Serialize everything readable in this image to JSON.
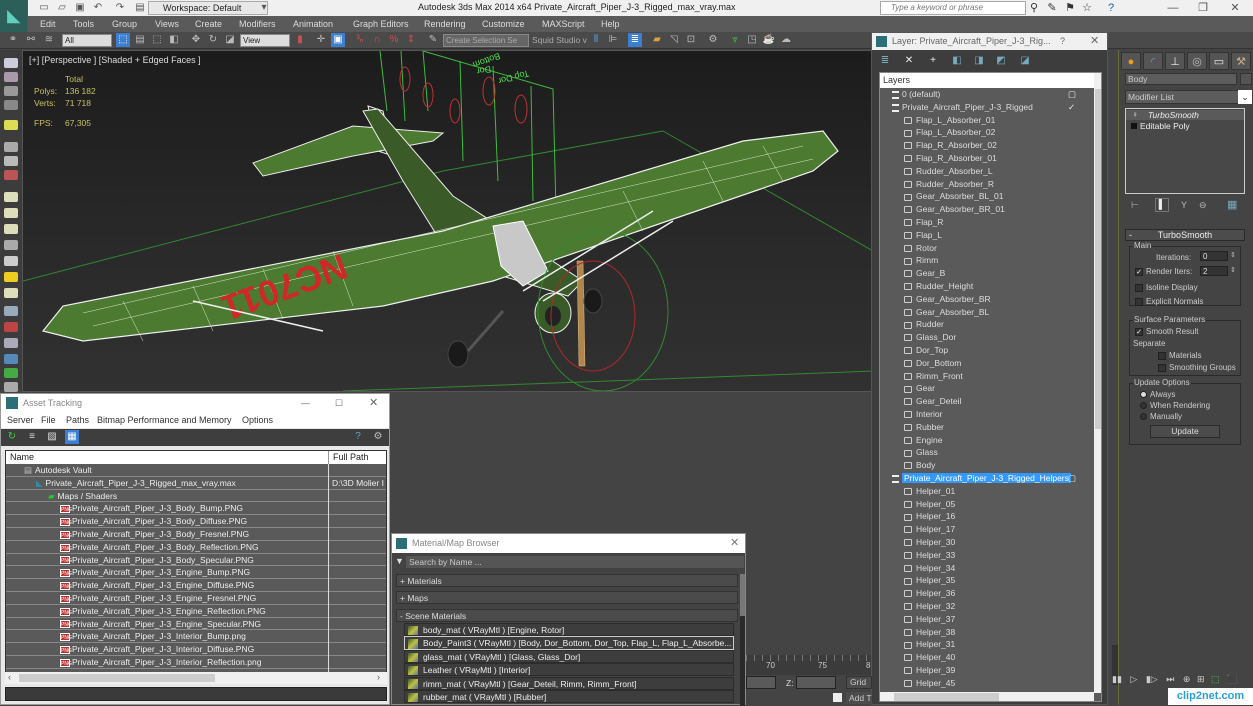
{
  "app": {
    "title": "Autodesk 3ds Max  2014 x64      Private_Aircraft_Piper_J-3_Rigged_max_vray.max",
    "workspace": "Workspace: Default",
    "search_placeholder": "Type a keyword or phrase"
  },
  "menu": [
    "Edit",
    "Tools",
    "Group",
    "Views",
    "Create",
    "Modifiers",
    "Animation",
    "Graph Editors",
    "Rendering",
    "Customize",
    "MAXScript",
    "Help"
  ],
  "toolbar": {
    "selection_filter": "All",
    "ref_coord": "View",
    "named_selection": "Create Selection Se",
    "custom_label": "Squid Studio v"
  },
  "viewport": {
    "label": "[+] [Perspective ] [Shaded + Edged Faces ]",
    "stats": {
      "header": "Total",
      "polys_label": "Polys:",
      "polys": "136 182",
      "verts_label": "Verts:",
      "verts": "71 718",
      "fps_label": "FPS:",
      "fps": "67,305"
    },
    "wing_text": "NC7011",
    "helper_labels": [
      "Bottom",
      "Dor",
      "Top Dor"
    ]
  },
  "layer_panel": {
    "title": "Layer: Private_Aircraft_Piper_J-3_Rig...",
    "help": "?",
    "column_header": "Layers",
    "rows": [
      {
        "label": "0 (default)",
        "type": "layer",
        "indent": 1
      },
      {
        "label": "Private_Aircraft_Piper_J-3_Rigged",
        "type": "layer",
        "indent": 1,
        "checked": true
      },
      {
        "label": "Flap_L_Absorber_01",
        "type": "object",
        "indent": 2
      },
      {
        "label": "Flap_L_Absorber_02",
        "type": "object",
        "indent": 2
      },
      {
        "label": "Flap_R_Absorber_02",
        "type": "object",
        "indent": 2
      },
      {
        "label": "Flap_R_Absorber_01",
        "type": "object",
        "indent": 2
      },
      {
        "label": "Rudder_Absorber_L",
        "type": "object",
        "indent": 2
      },
      {
        "label": "Rudder_Absorber_R",
        "type": "object",
        "indent": 2
      },
      {
        "label": "Gear_Absorber_BL_01",
        "type": "object",
        "indent": 2
      },
      {
        "label": "Gear_Absorber_BR_01",
        "type": "object",
        "indent": 2
      },
      {
        "label": "Flap_R",
        "type": "object",
        "indent": 2
      },
      {
        "label": "Flap_L",
        "type": "object",
        "indent": 2
      },
      {
        "label": "Rotor",
        "type": "object",
        "indent": 2
      },
      {
        "label": "Rimm",
        "type": "object",
        "indent": 2
      },
      {
        "label": "Gear_B",
        "type": "object",
        "indent": 2
      },
      {
        "label": "Rudder_Height",
        "type": "object",
        "indent": 2
      },
      {
        "label": "Gear_Absorber_BR",
        "type": "object",
        "indent": 2
      },
      {
        "label": "Gear_Absorber_BL",
        "type": "object",
        "indent": 2
      },
      {
        "label": "Rudder",
        "type": "object",
        "indent": 2
      },
      {
        "label": "Glass_Dor",
        "type": "object",
        "indent": 2
      },
      {
        "label": "Dor_Top",
        "type": "object",
        "indent": 2
      },
      {
        "label": "Dor_Bottom",
        "type": "object",
        "indent": 2
      },
      {
        "label": "Rimm_Front",
        "type": "object",
        "indent": 2
      },
      {
        "label": "Gear",
        "type": "object",
        "indent": 2
      },
      {
        "label": "Gear_Deteil",
        "type": "object",
        "indent": 2
      },
      {
        "label": "Interior",
        "type": "object",
        "indent": 2
      },
      {
        "label": "Rubber",
        "type": "object",
        "indent": 2
      },
      {
        "label": "Engine",
        "type": "object",
        "indent": 2
      },
      {
        "label": "Glass",
        "type": "object",
        "indent": 2
      },
      {
        "label": "Body",
        "type": "object",
        "indent": 2
      },
      {
        "label": "Private_Aircraft_Piper_J-3_Rigged_Helpers",
        "type": "layer",
        "indent": 1,
        "selected": true
      },
      {
        "label": "Helper_01",
        "type": "object",
        "indent": 2
      },
      {
        "label": "Helper_05",
        "type": "object",
        "indent": 2
      },
      {
        "label": "Helper_16",
        "type": "object",
        "indent": 2
      },
      {
        "label": "Helper_17",
        "type": "object",
        "indent": 2
      },
      {
        "label": "Helper_30",
        "type": "object",
        "indent": 2
      },
      {
        "label": "Helper_33",
        "type": "object",
        "indent": 2
      },
      {
        "label": "Helper_34",
        "type": "object",
        "indent": 2
      },
      {
        "label": "Helper_35",
        "type": "object",
        "indent": 2
      },
      {
        "label": "Helper_36",
        "type": "object",
        "indent": 2
      },
      {
        "label": "Helper_32",
        "type": "object",
        "indent": 2
      },
      {
        "label": "Helper_37",
        "type": "object",
        "indent": 2
      },
      {
        "label": "Helper_38",
        "type": "object",
        "indent": 2
      },
      {
        "label": "Helper_31",
        "type": "object",
        "indent": 2
      },
      {
        "label": "Helper_40",
        "type": "object",
        "indent": 2
      },
      {
        "label": "Helper_39",
        "type": "object",
        "indent": 2
      },
      {
        "label": "Helper_45",
        "type": "object",
        "indent": 2
      }
    ]
  },
  "command_panel": {
    "object_name": "Body",
    "modifier_list": "Modifier List",
    "stack": [
      "TurboSmooth",
      "Editable Poly"
    ],
    "rollout_title": "TurboSmooth",
    "main_group": "Main",
    "iterations_label": "Iterations:",
    "iterations": "0",
    "render_iters_label": "Render Iters:",
    "render_iters": "2",
    "render_iters_checked": true,
    "isoline_label": "Isoline Display",
    "explicit_label": "Explicit Normals",
    "surface_group": "Surface Parameters",
    "smooth_result_label": "Smooth Result",
    "smooth_result_checked": true,
    "separate_label": "Separate",
    "materials_label": "Materials",
    "smoothing_groups_label": "Smoothing Groups",
    "update_group": "Update Options",
    "always_label": "Always",
    "when_rendering_label": "When Rendering",
    "manually_label": "Manually",
    "update_button": "Update"
  },
  "asset_tracking": {
    "title": "Asset Tracking",
    "menu": [
      "Server",
      "File",
      "Paths",
      "Bitmap Performance and Memory",
      "Options"
    ],
    "columns": [
      "Name",
      "Full Path"
    ],
    "rows": [
      {
        "name": "Autodesk Vault",
        "path": "",
        "indent": 1,
        "icon": "vault"
      },
      {
        "name": "Private_Aircraft_Piper_J-3_Rigged_max_vray.max",
        "path": "D:\\3D Molier I",
        "indent": 2,
        "icon": "max"
      },
      {
        "name": "Maps / Shaders",
        "path": "",
        "indent": 3,
        "icon": "maps"
      },
      {
        "name": "Private_Aircraft_Piper_J-3_Body_Bump.PNG",
        "path": "",
        "indent": 4,
        "icon": "png"
      },
      {
        "name": "Private_Aircraft_Piper_J-3_Body_Diffuse.PNG",
        "path": "",
        "indent": 4,
        "icon": "png"
      },
      {
        "name": "Private_Aircraft_Piper_J-3_Body_Fresnel.PNG",
        "path": "",
        "indent": 4,
        "icon": "png"
      },
      {
        "name": "Private_Aircraft_Piper_J-3_Body_Reflection.PNG",
        "path": "",
        "indent": 4,
        "icon": "png"
      },
      {
        "name": "Private_Aircraft_Piper_J-3_Body_Specular.PNG",
        "path": "",
        "indent": 4,
        "icon": "png"
      },
      {
        "name": "Private_Aircraft_Piper_J-3_Engine_Bump.PNG",
        "path": "",
        "indent": 4,
        "icon": "png"
      },
      {
        "name": "Private_Aircraft_Piper_J-3_Engine_Diffuse.PNG",
        "path": "",
        "indent": 4,
        "icon": "png"
      },
      {
        "name": "Private_Aircraft_Piper_J-3_Engine_Fresnel.PNG",
        "path": "",
        "indent": 4,
        "icon": "png"
      },
      {
        "name": "Private_Aircraft_Piper_J-3_Engine_Reflection.PNG",
        "path": "",
        "indent": 4,
        "icon": "png"
      },
      {
        "name": "Private_Aircraft_Piper_J-3_Engine_Specular.PNG",
        "path": "",
        "indent": 4,
        "icon": "png"
      },
      {
        "name": "Private_Aircraft_Piper_J-3_Interior_Bump.png",
        "path": "",
        "indent": 4,
        "icon": "png"
      },
      {
        "name": "Private_Aircraft_Piper_J-3_Interior_Diffuse.PNG",
        "path": "",
        "indent": 4,
        "icon": "png"
      },
      {
        "name": "Private_Aircraft_Piper_J-3_Interior_Reflection.png",
        "path": "",
        "indent": 4,
        "icon": "png"
      }
    ]
  },
  "material_browser": {
    "title": "Material/Map Browser",
    "search_placeholder": "Search by Name ...",
    "sections": [
      "+ Materials",
      "+ Maps",
      "- Scene Materials"
    ],
    "materials": [
      {
        "label": "body_mat  ( VRayMtl )  [Engine, Rotor]"
      },
      {
        "label": "Body_Paint3  ( VRayMtl )  [Body, Dor_Bottom, Dor_Top, Flap_L, Flap_L_Absorbe...",
        "selected": true
      },
      {
        "label": "glass_mat  ( VRayMtl )  [Glass, Glass_Dor]"
      },
      {
        "label": "Leather  ( VRayMtl )  [Interior]"
      },
      {
        "label": "rimm_mat  ( VRayMtl )  [Gear_Deteil, Rimm, Rimm_Front]"
      },
      {
        "label": "rubber_mat  ( VRayMtl )  [Rubber]"
      }
    ]
  },
  "timeline": {
    "ticks": [
      "70",
      "75",
      "8"
    ],
    "z_label": "Z:",
    "grid_label": "Grid",
    "add_label": "Add T"
  },
  "watermark": "clip2net.com"
}
